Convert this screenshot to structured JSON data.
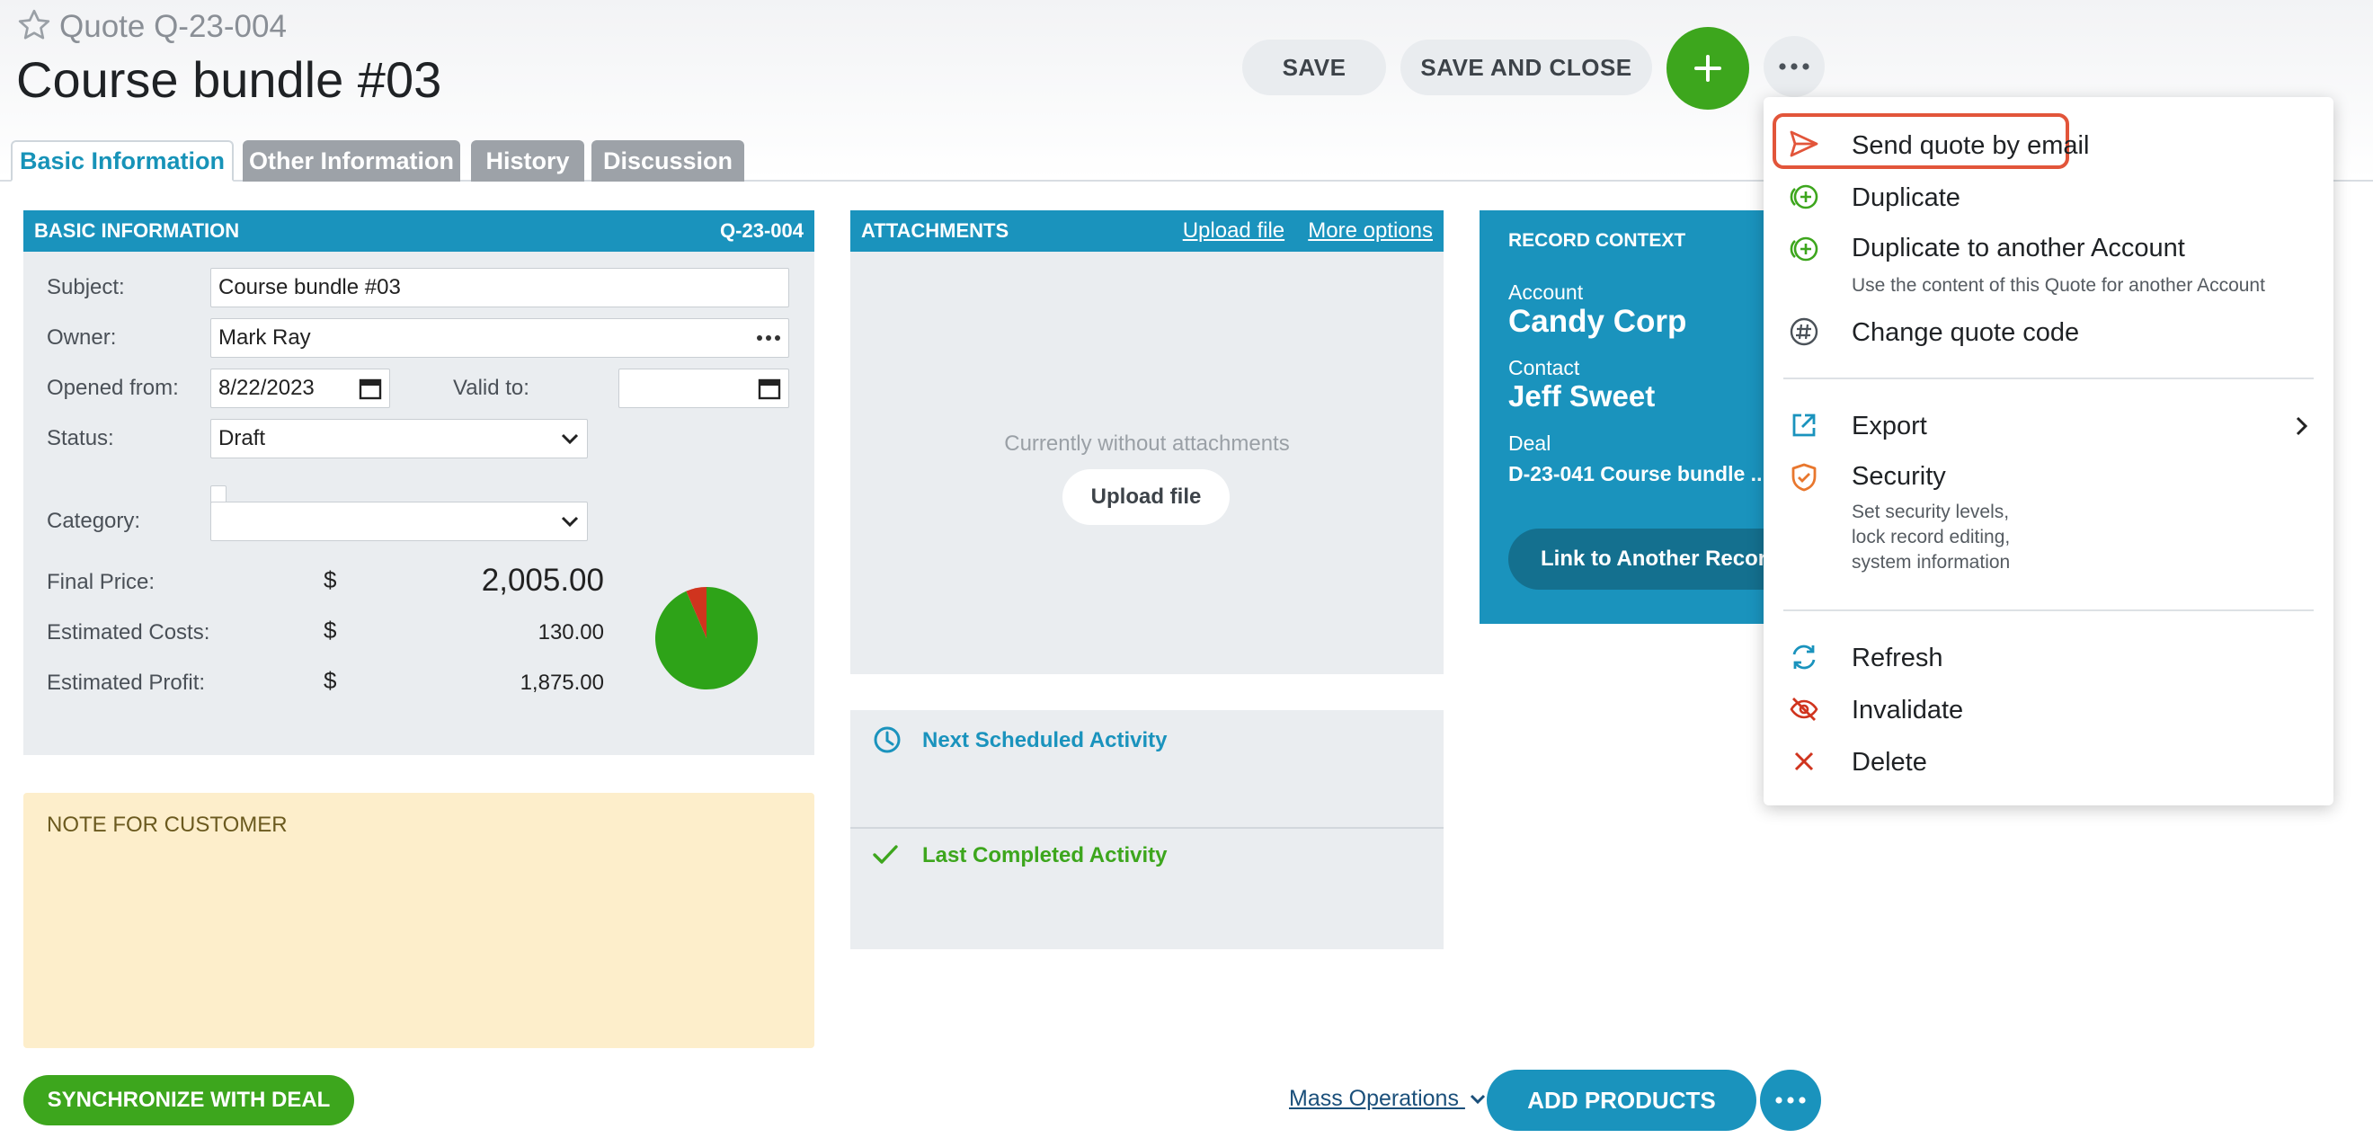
{
  "header": {
    "record_type": "Quote Q-23-004",
    "title": "Course bundle #03",
    "save_label": "SAVE",
    "save_close_label": "SAVE AND CLOSE"
  },
  "tabs": [
    {
      "label": "Basic Information",
      "active": true
    },
    {
      "label": "Other Information",
      "active": false
    },
    {
      "label": "History",
      "active": false
    },
    {
      "label": "Discussion",
      "active": false
    }
  ],
  "basic": {
    "header": "BASIC INFORMATION",
    "code": "Q-23-004",
    "subject_label": "Subject:",
    "subject_value": "Course bundle #03",
    "owner_label": "Owner:",
    "owner_value": "Mark Ray",
    "opened_label": "Opened from:",
    "opened_value": "8/22/2023",
    "valid_label": "Valid to:",
    "valid_value": "",
    "status_label": "Status:",
    "status_value": "Draft",
    "category_label": "Category:",
    "category_value": "",
    "currency": "$",
    "final_price_label": "Final Price:",
    "final_price": "2,005.00",
    "est_costs_label": "Estimated Costs:",
    "est_costs": "130.00",
    "est_profit_label": "Estimated Profit:",
    "est_profit": "1,875.00",
    "pie": {
      "costs": 130,
      "profit": 1875,
      "cost_color": "#d0341e",
      "profit_color": "#2ea318"
    }
  },
  "note": {
    "title": "NOTE FOR CUSTOMER"
  },
  "attachments": {
    "header": "ATTACHMENTS",
    "upload_link": "Upload file",
    "more_link": "More options",
    "empty_text": "Currently without attachments",
    "upload_button": "Upload file"
  },
  "activities": {
    "next": "Next Scheduled Activity",
    "last": "Last Completed Activity"
  },
  "context": {
    "header": "RECORD CONTEXT",
    "account_label": "Account",
    "account_value": "Candy Corp",
    "contact_label": "Contact",
    "contact_value": "Jeff Sweet",
    "deal_label": "Deal",
    "deal_value": "D-23-041 Course bundle ...",
    "link_button": "Link to Another Record"
  },
  "bottom": {
    "sync_label": "SYNCHRONIZE WITH DEAL",
    "mass_ops": "Mass Operations",
    "add_products": "ADD PRODUCTS"
  },
  "menu": {
    "send_email": "Send quote by email",
    "duplicate": "Duplicate",
    "duplicate_account": "Duplicate to another Account",
    "duplicate_account_desc": "Use the content of this Quote for another Account",
    "change_code": "Change quote code",
    "export": "Export",
    "security": "Security",
    "security_desc_1": "Set security levels,",
    "security_desc_2": "lock record editing,",
    "security_desc_3": "system information",
    "refresh": "Refresh",
    "invalidate": "Invalidate",
    "delete": "Delete"
  },
  "colors": {
    "accent": "#1a93bd",
    "green": "#3da61d",
    "highlight": "#e2553a",
    "note_bg": "#fdeecb"
  },
  "icons": [
    "star-icon",
    "plus-icon",
    "more-icon",
    "calendar-icon",
    "chevron-down-icon",
    "clock-icon",
    "check-icon",
    "send-icon",
    "duplicate-icon",
    "hash-icon",
    "export-icon",
    "chevron-right-icon",
    "shield-icon",
    "refresh-icon",
    "eye-off-icon",
    "close-icon"
  ]
}
